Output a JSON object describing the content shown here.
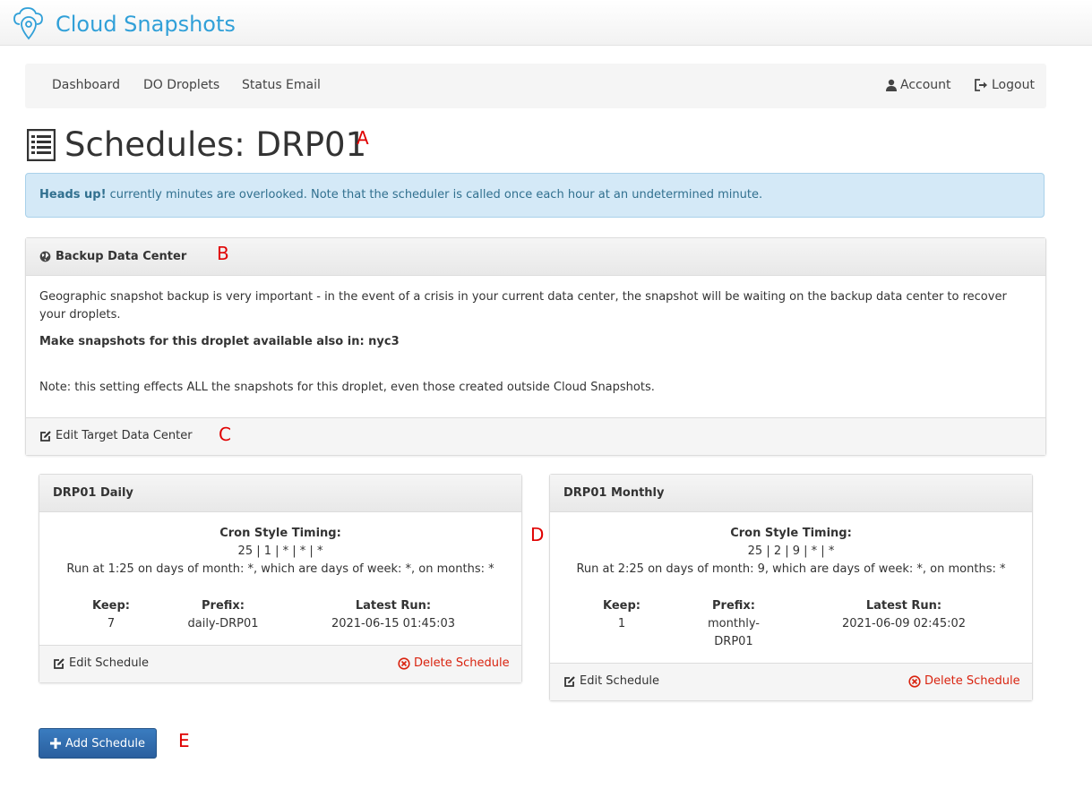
{
  "brand": {
    "name": "Cloud Snapshots"
  },
  "nav": {
    "left": [
      "Dashboard",
      "DO Droplets",
      "Status Email"
    ],
    "account": "Account",
    "logout": "Logout"
  },
  "page": {
    "title": "Schedules: DRP01"
  },
  "alert": {
    "strong": "Heads up!",
    "text": " currently minutes are overlooked. Note that the scheduler is called once each hour at an undetermined minute."
  },
  "backup_panel": {
    "title": "Backup Data Center",
    "description": "Geographic snapshot backup is very important - in the event of a crisis in your current data center, the snapshot will be waiting on the backup data center to recover your droplets.",
    "availability": "Make snapshots for this droplet available also in: nyc3",
    "note": "Note: this setting effects ALL the snapshots for this droplet, even those created outside Cloud Snapshots.",
    "edit_label": "Edit Target Data Center"
  },
  "schedules": [
    {
      "title": "DRP01 Daily",
      "cron_label": "Cron Style Timing:",
      "cron": "25 | 1 | * | * | *",
      "run_text": "Run at 1:25 on days of month: *, which are days of week: *, on months: *",
      "keep_label": "Keep:",
      "keep": "7",
      "prefix_label": "Prefix:",
      "prefix": "daily-DRP01",
      "latest_label": "Latest Run:",
      "latest": "2021-06-15 01:45:03",
      "edit_label": "Edit Schedule",
      "delete_label": "Delete Schedule"
    },
    {
      "title": "DRP01 Monthly",
      "cron_label": "Cron Style Timing:",
      "cron": "25 | 2 | 9 | * | *",
      "run_text": "Run at 2:25 on days of month: 9, which are days of week: *, on months: *",
      "keep_label": "Keep:",
      "keep": "1",
      "prefix_label": "Prefix:",
      "prefix_line1": "monthly-",
      "prefix_line2": "DRP01",
      "latest_label": "Latest Run:",
      "latest": "2021-06-09 02:45:02",
      "edit_label": "Edit Schedule",
      "delete_label": "Delete Schedule"
    }
  ],
  "add_button": "Add Schedule",
  "annotations": {
    "a": "A",
    "b": "B",
    "c": "C",
    "d": "D",
    "e": "E"
  },
  "colors": {
    "brand": "#31a0d8",
    "alert_bg": "#d4e9f7",
    "alert_text": "#31708f",
    "delete": "#d9230f",
    "primary": "#2a5f9e",
    "annotation": "#e00000"
  }
}
